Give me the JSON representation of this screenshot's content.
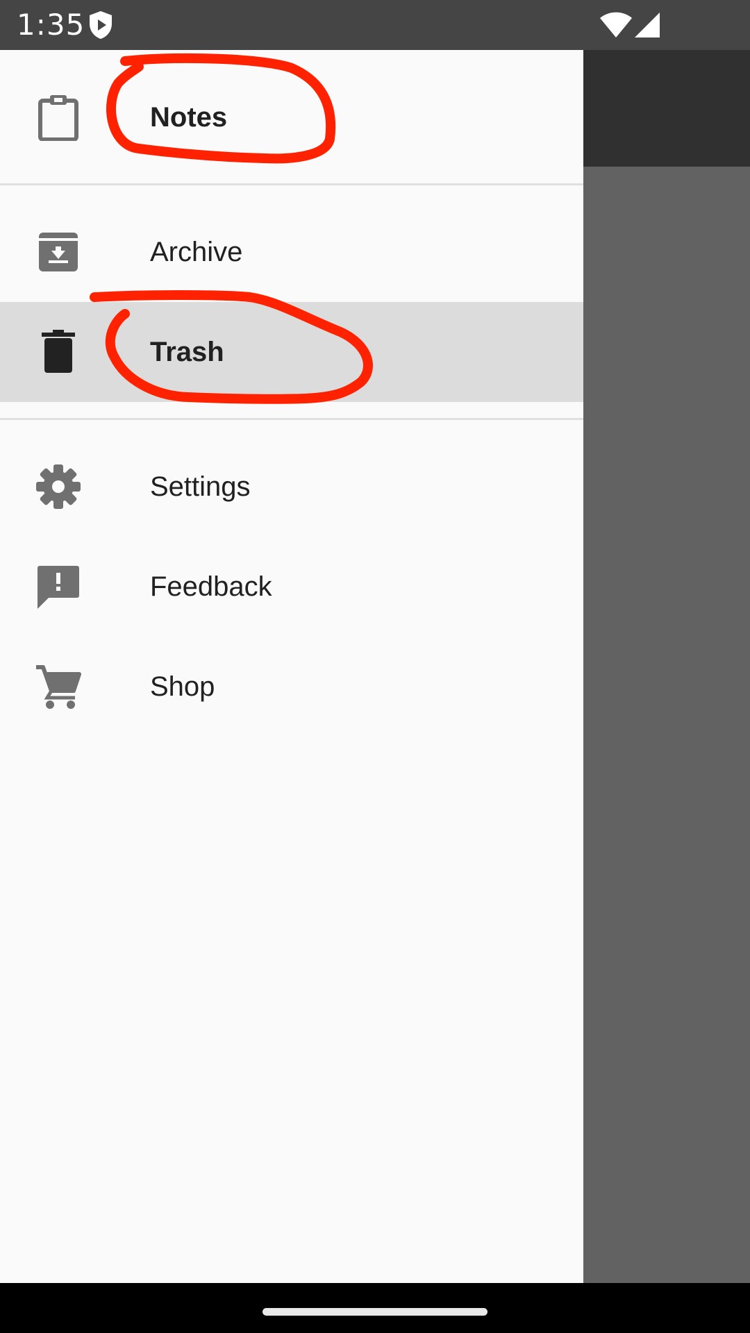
{
  "status_bar": {
    "time": "1:35",
    "icons": [
      "shield-play-icon",
      "wifi-icon",
      "signal-icon"
    ]
  },
  "drawer": {
    "items": [
      {
        "label": "Notes",
        "icon": "clipboard-icon",
        "bold": true,
        "selected": false
      },
      {
        "label": "Archive",
        "icon": "archive-icon",
        "bold": false,
        "selected": false
      },
      {
        "label": "Trash",
        "icon": "trash-icon",
        "bold": true,
        "selected": true
      },
      {
        "label": "Settings",
        "icon": "gear-icon",
        "bold": false,
        "selected": false
      },
      {
        "label": "Feedback",
        "icon": "feedback-icon",
        "bold": false,
        "selected": false
      },
      {
        "label": "Shop",
        "icon": "cart-icon",
        "bold": false,
        "selected": false
      }
    ]
  },
  "colors": {
    "drawer_bg": "#fafafa",
    "selected_bg": "#dcdcdc",
    "scrim": "#626262",
    "annotation": "#ff2200"
  }
}
